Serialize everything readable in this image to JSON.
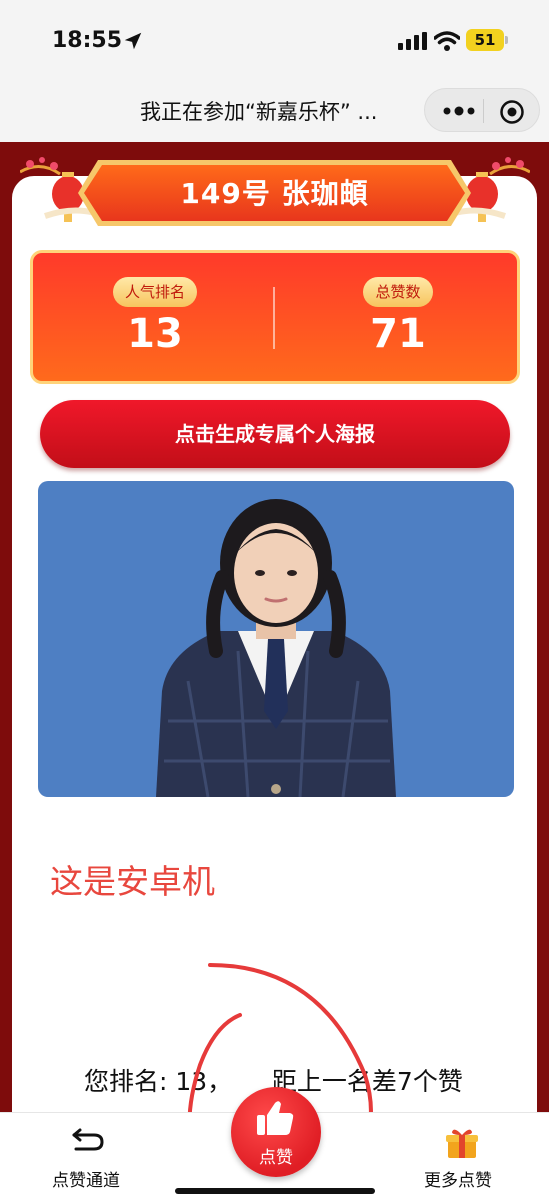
{
  "status_bar": {
    "time": "18:55",
    "battery": "51",
    "icons": [
      "location-arrow-icon",
      "signal-icon",
      "wifi-icon",
      "battery-icon"
    ]
  },
  "nav": {
    "title": "我正在参加“新嘉乐杯” ...",
    "more_icon": "more-dots-icon",
    "close_icon": "close-target-icon"
  },
  "contestant": {
    "name_banner": "149号 张珈頔"
  },
  "stats": {
    "rank_label": "人气排名",
    "rank_value": "13",
    "likes_label": "总赞数",
    "likes_value": "71"
  },
  "poster_button": "点击生成专属个人海报",
  "note": "这是安卓机",
  "rank_line": "您排名: 13，     距上一名差7个赞",
  "bottom_bar": {
    "left_label": "点赞通道",
    "center_label": "点赞",
    "right_label": "更多点赞"
  },
  "colors": {
    "page_bg": "#7e0c0c",
    "accent_red": "#e01e25",
    "stats_orange": "#ff5a22",
    "photo_bg": "#4e7fc3",
    "note_red": "#e8473e"
  }
}
